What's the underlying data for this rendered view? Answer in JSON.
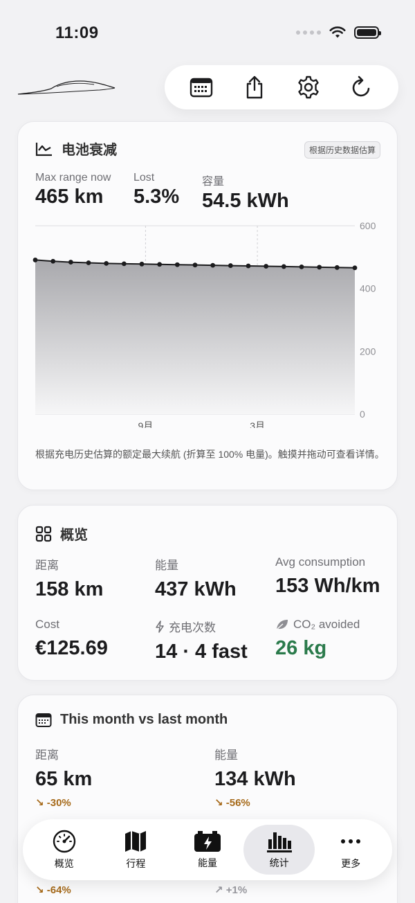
{
  "status": {
    "time": "11:09"
  },
  "toolbar": {
    "calendar_icon": "calendar-icon",
    "share_icon": "share-icon",
    "settings_icon": "gear-icon",
    "refresh_icon": "refresh-icon"
  },
  "battery": {
    "title": "电池衰减",
    "badge": "根据历史数据估算",
    "metrics": [
      {
        "label": "Max range now",
        "value": "465 km"
      },
      {
        "label": "Lost",
        "value": "5.3%"
      },
      {
        "label": "容量",
        "value": "54.5 kWh"
      }
    ],
    "note": "根据充电历史估算的额定最大续航 (折算至 100% 电量)。触摸并拖动可查看详情。"
  },
  "chart_data": {
    "type": "area",
    "ylim": [
      0,
      600
    ],
    "y_ticks": [
      "600",
      "400",
      "200",
      "0"
    ],
    "x_labels": [
      "9月",
      "3月"
    ],
    "values": [
      491,
      487,
      484,
      482,
      480,
      479,
      478,
      477,
      476,
      475,
      474,
      473,
      472,
      471,
      470,
      469,
      468,
      467,
      466
    ],
    "line_color": "#1c1c1e"
  },
  "overview": {
    "title": "概览",
    "metrics": [
      {
        "label": "距离",
        "value": "158 km"
      },
      {
        "label": "能量",
        "value": "437 kWh"
      },
      {
        "label": "Avg consumption",
        "value": "153 Wh/km"
      },
      {
        "label": "Cost",
        "value": "€125.69"
      },
      {
        "label": "充电次数",
        "value": "14 · 4 fast"
      },
      {
        "label": "CO₂ avoided",
        "value": "26 kg"
      }
    ]
  },
  "month": {
    "title": "This month vs last month",
    "metrics": [
      {
        "label": "距离",
        "value": "65 km",
        "trend": "↘ -30%"
      },
      {
        "label": "能量",
        "value": "134 kWh",
        "trend": "↘ -56%"
      }
    ],
    "partial_trends": [
      "↘ -64%",
      "↗ +1%"
    ]
  },
  "tabs": [
    {
      "label": "概览",
      "icon": "speedometer-icon"
    },
    {
      "label": "行程",
      "icon": "map-icon"
    },
    {
      "label": "能量",
      "icon": "battery-bolt-icon"
    },
    {
      "label": "统计",
      "icon": "bar-chart-icon"
    },
    {
      "label": "更多",
      "icon": "ellipsis-icon"
    }
  ],
  "active_tab": "统计"
}
